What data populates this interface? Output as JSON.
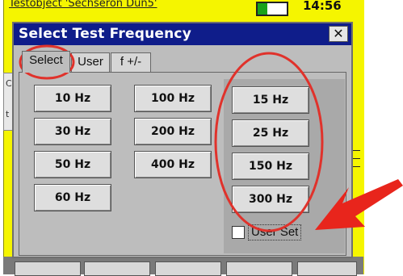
{
  "background": {
    "title": "Testobject 'Sechseron Dun5'",
    "time": "14:56",
    "left_letters": [
      "C",
      "t"
    ]
  },
  "dialog": {
    "title": "Select Test Frequency",
    "close_glyph": "✕",
    "tabs": [
      {
        "label": "Select",
        "active": true
      },
      {
        "label": "User",
        "active": false
      },
      {
        "label": "f +/-",
        "active": false
      }
    ],
    "left_buttons": [
      "10 Hz",
      "30 Hz",
      "50 Hz",
      "60 Hz"
    ],
    "middle_buttons": [
      "100 Hz",
      "200 Hz",
      "400 Hz"
    ],
    "right_buttons": [
      "15 Hz",
      "25 Hz",
      "150 Hz",
      "300 Hz"
    ],
    "user_set": {
      "label": "User Set",
      "checked": false
    }
  },
  "annotations": {
    "highlight_color": "#e0322b",
    "arrow_color": "#e8251c"
  }
}
